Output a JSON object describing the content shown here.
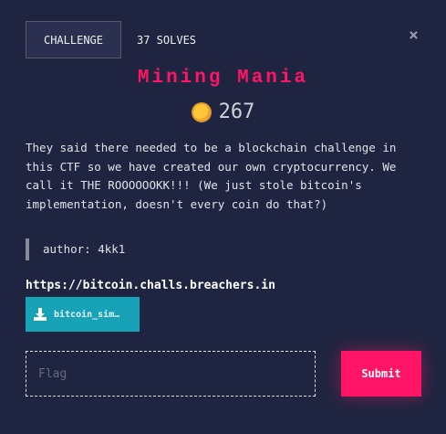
{
  "header": {
    "tab_label": "CHALLENGE",
    "solves": "37 SOLVES",
    "close_icon": "×"
  },
  "challenge": {
    "title": "Mining Mania",
    "points": "267",
    "description": "They said there needed to be a blockchain challenge in this CTF so we have created our own cryptocurrency. We call it THE ROOOOOOKK!!! (We just stole bitcoin's implementation, doesn't every coin do that?)",
    "author": "author: 4kk1",
    "url": "https://bitcoin.challs.breachers.in",
    "file_label": "bitcoin_sim…"
  },
  "form": {
    "flag_placeholder": "Flag",
    "submit_label": "Submit"
  },
  "colors": {
    "accent": "#ff1466",
    "download": "#17a2b8",
    "background": "#1f2540"
  }
}
